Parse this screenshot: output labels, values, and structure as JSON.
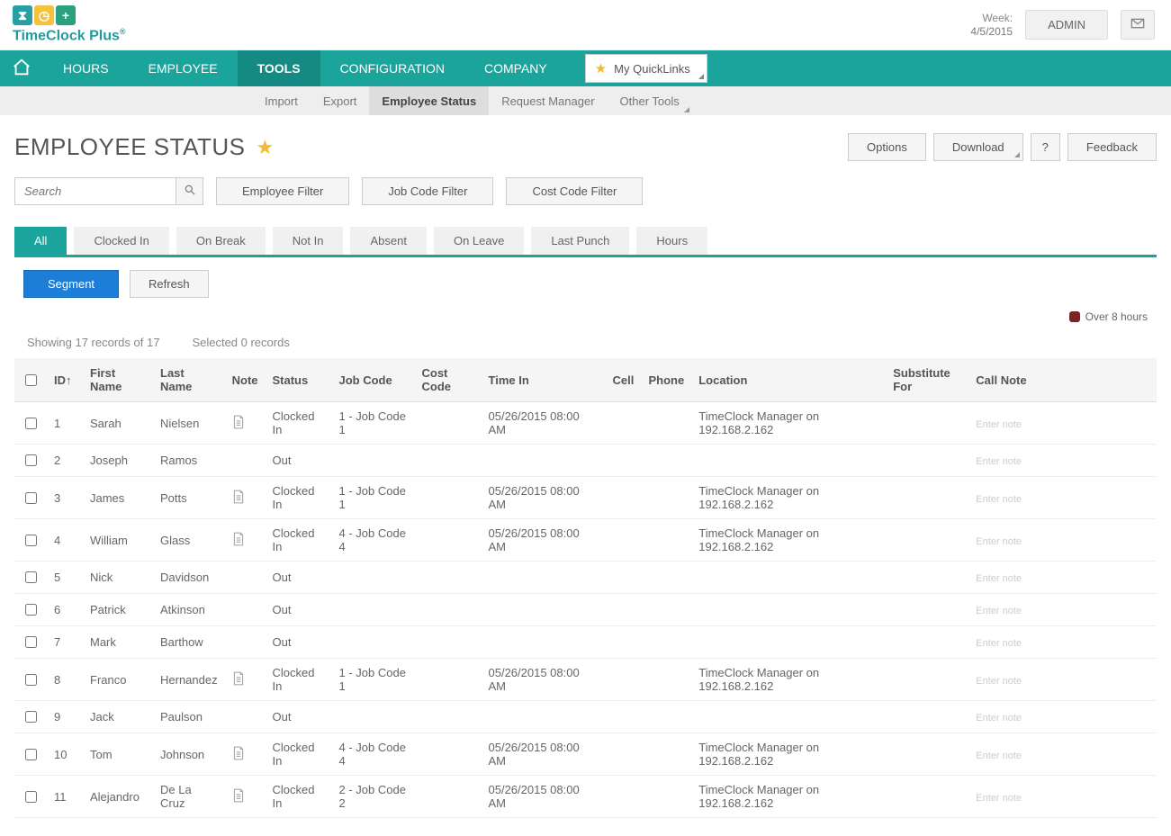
{
  "brand": {
    "name": "TimeClock Plus",
    "reg": "®"
  },
  "header": {
    "week_label": "Week:",
    "week_value": "4/5/2015",
    "admin_btn": "ADMIN"
  },
  "main_nav": [
    "HOURS",
    "EMPLOYEE",
    "TOOLS",
    "CONFIGURATION",
    "COMPANY"
  ],
  "main_nav_active": 2,
  "quicklinks_label": "My QuickLinks",
  "sub_nav": [
    "Import",
    "Export",
    "Employee Status",
    "Request Manager",
    "Other Tools"
  ],
  "sub_nav_active": 2,
  "sub_nav_more": [
    4
  ],
  "page_title": "EMPLOYEE STATUS",
  "title_actions": {
    "options": "Options",
    "download": "Download",
    "help": "?",
    "feedback": "Feedback"
  },
  "search": {
    "placeholder": "Search"
  },
  "filter_buttons": [
    "Employee Filter",
    "Job Code Filter",
    "Cost Code Filter"
  ],
  "tabs": [
    "All",
    "Clocked In",
    "On Break",
    "Not In",
    "Absent",
    "On Leave",
    "Last Punch",
    "Hours"
  ],
  "tabs_active": 0,
  "segment_btn": "Segment",
  "refresh_btn": "Refresh",
  "legend": {
    "over8": "Over 8 hours"
  },
  "meta": {
    "showing": "Showing 17 records of 17",
    "selected": "Selected 0 records"
  },
  "columns": [
    "",
    "ID↑",
    "First Name",
    "Last Name",
    "Note",
    "Status",
    "Job Code",
    "Cost Code",
    "Time In",
    "Cell",
    "Phone",
    "Location",
    "Substitute For",
    "Call Note"
  ],
  "call_note_placeholder": "Enter note",
  "rows": [
    {
      "id": "1",
      "fn": "Sarah",
      "ln": "Nielsen",
      "note": true,
      "status": "Clocked In",
      "job": "1 - Job Code 1",
      "cost": "",
      "time": "05/26/2015 08:00 AM",
      "cell": "",
      "phone": "",
      "loc": "TimeClock Manager on 192.168.2.162",
      "sub": ""
    },
    {
      "id": "2",
      "fn": "Joseph",
      "ln": "Ramos",
      "note": false,
      "status": "Out",
      "job": "",
      "cost": "",
      "time": "",
      "cell": "",
      "phone": "",
      "loc": "",
      "sub": ""
    },
    {
      "id": "3",
      "fn": "James",
      "ln": "Potts",
      "note": true,
      "status": "Clocked In",
      "job": "1 - Job Code 1",
      "cost": "",
      "time": "05/26/2015 08:00 AM",
      "cell": "",
      "phone": "",
      "loc": "TimeClock Manager on 192.168.2.162",
      "sub": ""
    },
    {
      "id": "4",
      "fn": "William",
      "ln": "Glass",
      "note": true,
      "status": "Clocked In",
      "job": "4 - Job Code 4",
      "cost": "",
      "time": "05/26/2015 08:00 AM",
      "cell": "",
      "phone": "",
      "loc": "TimeClock Manager on 192.168.2.162",
      "sub": ""
    },
    {
      "id": "5",
      "fn": "Nick",
      "ln": "Davidson",
      "note": false,
      "status": "Out",
      "job": "",
      "cost": "",
      "time": "",
      "cell": "",
      "phone": "",
      "loc": "",
      "sub": ""
    },
    {
      "id": "6",
      "fn": "Patrick",
      "ln": "Atkinson",
      "note": false,
      "status": "Out",
      "job": "",
      "cost": "",
      "time": "",
      "cell": "",
      "phone": "",
      "loc": "",
      "sub": ""
    },
    {
      "id": "7",
      "fn": "Mark",
      "ln": "Barthow",
      "note": false,
      "status": "Out",
      "job": "",
      "cost": "",
      "time": "",
      "cell": "",
      "phone": "",
      "loc": "",
      "sub": ""
    },
    {
      "id": "8",
      "fn": "Franco",
      "ln": "Hernandez",
      "note": true,
      "status": "Clocked In",
      "job": "1 - Job Code 1",
      "cost": "",
      "time": "05/26/2015 08:00 AM",
      "cell": "",
      "phone": "",
      "loc": "TimeClock Manager on 192.168.2.162",
      "sub": ""
    },
    {
      "id": "9",
      "fn": "Jack",
      "ln": "Paulson",
      "note": false,
      "status": "Out",
      "job": "",
      "cost": "",
      "time": "",
      "cell": "",
      "phone": "",
      "loc": "",
      "sub": ""
    },
    {
      "id": "10",
      "fn": "Tom",
      "ln": "Johnson",
      "note": true,
      "status": "Clocked In",
      "job": "4 - Job Code 4",
      "cost": "",
      "time": "05/26/2015 08:00 AM",
      "cell": "",
      "phone": "",
      "loc": "TimeClock Manager on 192.168.2.162",
      "sub": ""
    },
    {
      "id": "11",
      "fn": "Alejandro",
      "ln": "De La Cruz",
      "note": true,
      "status": "Clocked In",
      "job": "2 - Job Code 2",
      "cost": "",
      "time": "05/26/2015 08:00 AM",
      "cell": "",
      "phone": "",
      "loc": "TimeClock Manager on 192.168.2.162",
      "sub": ""
    }
  ]
}
